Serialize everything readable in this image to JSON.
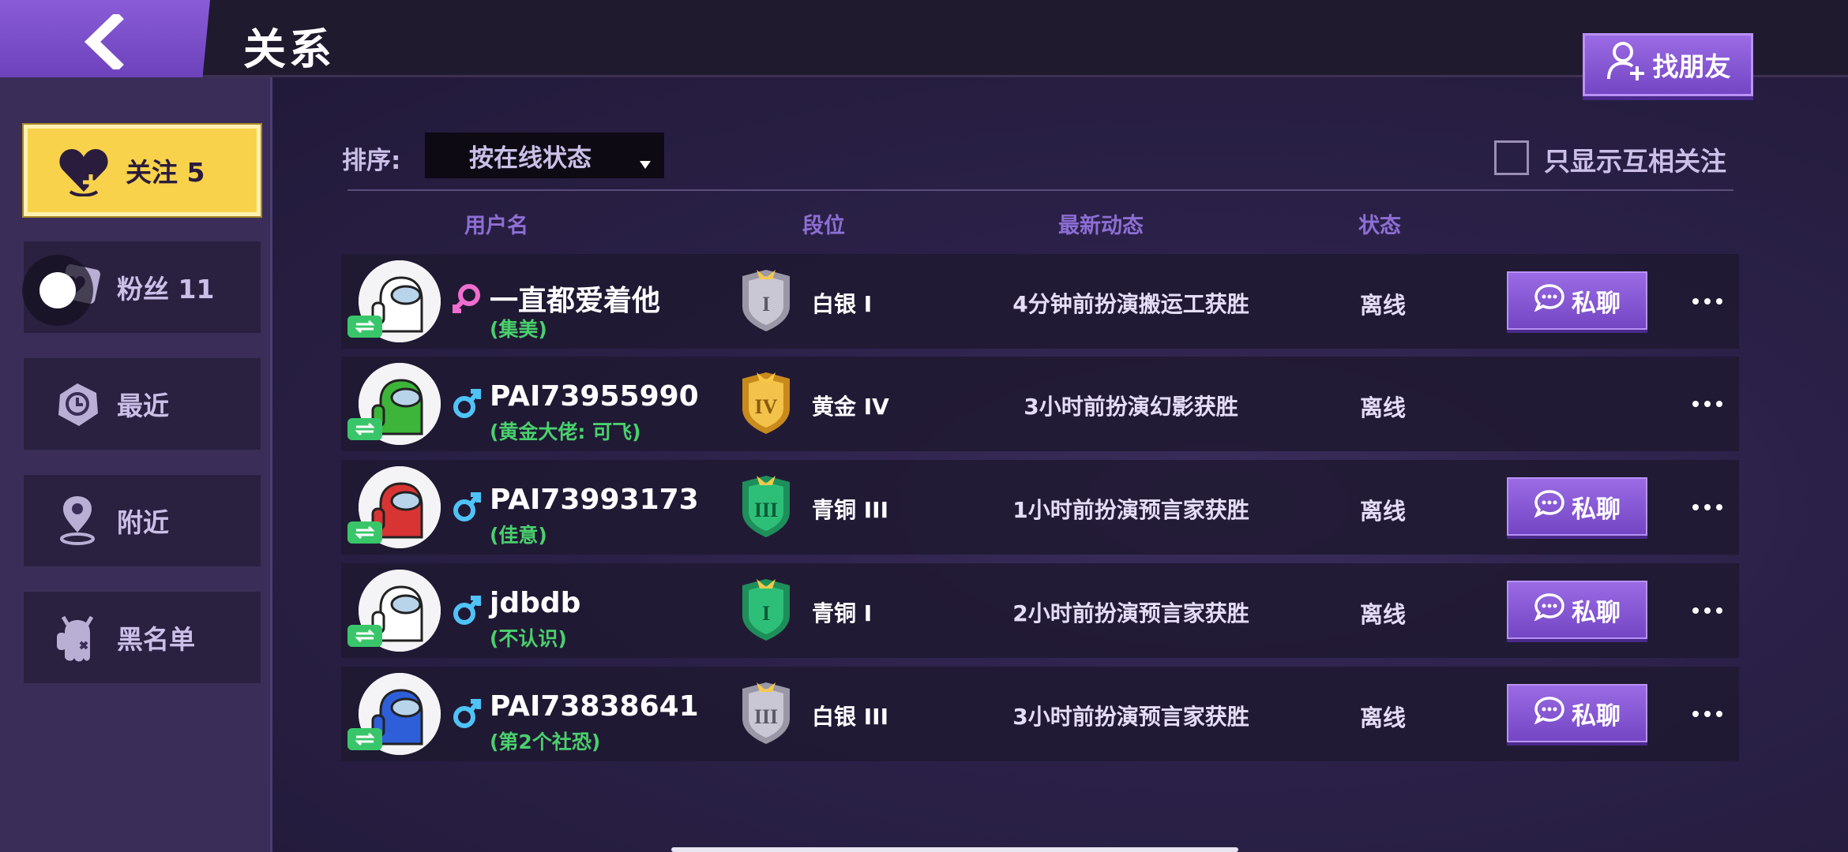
{
  "header": {
    "title": "关系",
    "find_friend_label": "找朋友"
  },
  "sidebar": {
    "items": [
      {
        "label": "关注 5",
        "icon": "heart-follow-icon",
        "active": true
      },
      {
        "label": "粉丝 11",
        "icon": "fans-card-icon",
        "active": false
      },
      {
        "label": "最近",
        "icon": "recent-clock-icon",
        "active": false
      },
      {
        "label": "附近",
        "icon": "location-pin-icon",
        "active": false
      },
      {
        "label": "黑名单",
        "icon": "blacklist-crewmate-icon",
        "active": false
      }
    ]
  },
  "toolbar": {
    "sort_label": "排序:",
    "sort_value": "按在线状态",
    "mutual_only_label": "只显示互相关注",
    "mutual_only_checked": false
  },
  "columns": {
    "username": "用户名",
    "rank": "段位",
    "activity": "最新动态",
    "status": "状态"
  },
  "chat_label": "私聊",
  "rows": [
    {
      "username": "一直都爱着他",
      "remark": "(集美)",
      "gender": "female",
      "avatar_color": "#ffffff",
      "rank": "白银 I",
      "rank_numeral": "I",
      "rank_tier": "silver",
      "activity": "4分钟前扮演搬运工获胜",
      "status": "离线",
      "has_chat": true
    },
    {
      "username": "PAI73955990",
      "remark": "(黄金大佬: 可飞)",
      "gender": "male",
      "avatar_color": "#3db43a",
      "rank": "黄金 IV",
      "rank_numeral": "IV",
      "rank_tier": "gold",
      "activity": "3小时前扮演幻影获胜",
      "status": "离线",
      "has_chat": false
    },
    {
      "username": "PAI73993173",
      "remark": "(佳意)",
      "gender": "male",
      "avatar_color": "#d83434",
      "rank": "青铜 III",
      "rank_numeral": "III",
      "rank_tier": "bronze",
      "activity": "1小时前扮演预言家获胜",
      "status": "离线",
      "has_chat": true
    },
    {
      "username": "jdbdb",
      "remark": "(不认识)",
      "gender": "male",
      "avatar_color": "#ffffff",
      "rank": "青铜 I",
      "rank_numeral": "I",
      "rank_tier": "bronze",
      "activity": "2小时前扮演预言家获胜",
      "status": "离线",
      "has_chat": true
    },
    {
      "username": "PAI73838641",
      "remark": "(第2个社恐)",
      "gender": "male",
      "avatar_color": "#2f5fd8",
      "rank": "白银 III",
      "rank_numeral": "III",
      "rank_tier": "silver",
      "activity": "3小时前扮演预言家获胜",
      "status": "离线",
      "has_chat": true
    }
  ],
  "colors": {
    "accent_purple": "#7f52d0",
    "active_tab_yellow": "#f8d24b",
    "remark_green": "#49d06d",
    "male_blue": "#4fc3f7",
    "female_pink": "#f06ecf"
  }
}
